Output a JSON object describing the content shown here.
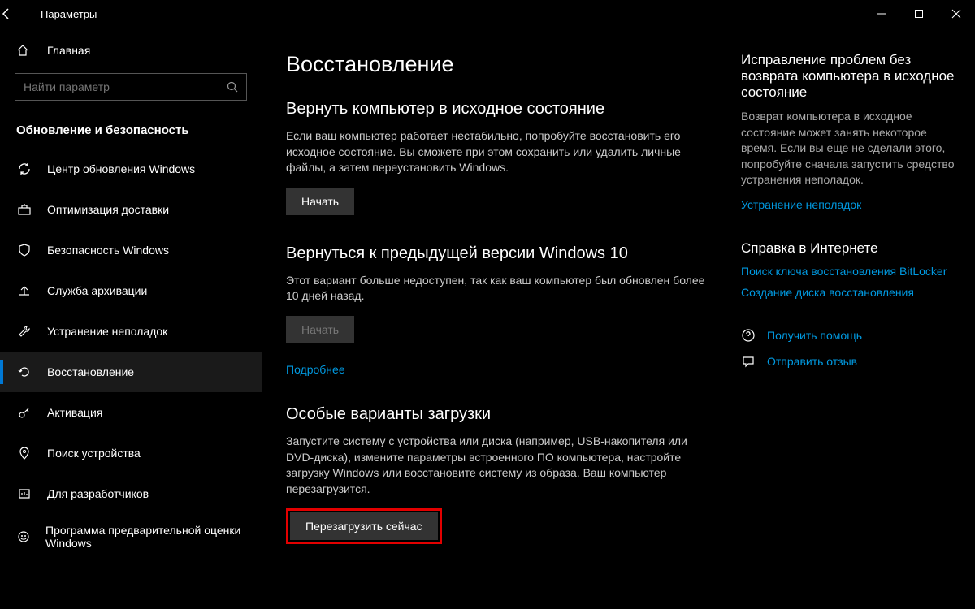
{
  "titlebar": {
    "title": "Параметры"
  },
  "sidebar": {
    "home": "Главная",
    "search_placeholder": "Найти параметр",
    "category": "Обновление и безопасность",
    "items": [
      {
        "label": "Центр обновления Windows"
      },
      {
        "label": "Оптимизация доставки"
      },
      {
        "label": "Безопасность Windows"
      },
      {
        "label": "Служба архивации"
      },
      {
        "label": "Устранение неполадок"
      },
      {
        "label": "Восстановление"
      },
      {
        "label": "Активация"
      },
      {
        "label": "Поиск устройства"
      },
      {
        "label": "Для разработчиков"
      },
      {
        "label": "Программа предварительной оценки Windows"
      }
    ]
  },
  "main": {
    "title": "Восстановление",
    "sections": {
      "reset": {
        "heading": "Вернуть компьютер в исходное состояние",
        "text": "Если ваш компьютер работает нестабильно, попробуйте восстановить его исходное состояние. Вы сможете при этом сохранить или удалить личные файлы, а затем переустановить Windows.",
        "button": "Начать"
      },
      "goback": {
        "heading": "Вернуться к предыдущей версии Windows 10",
        "text": "Этот вариант больше недоступен, так как ваш компьютер был обновлен более 10 дней назад.",
        "button": "Начать",
        "link": "Подробнее"
      },
      "advanced": {
        "heading": "Особые варианты загрузки",
        "text": "Запустите систему с устройства или диска (например, USB-накопителя или DVD-диска), измените параметры встроенного ПО компьютера, настройте загрузку Windows или восстановите систему из образа. Ваш компьютер перезагрузится.",
        "button": "Перезагрузить сейчас"
      }
    }
  },
  "right": {
    "fix": {
      "heading": "Исправление проблем без возврата компьютера в исходное состояние",
      "text": "Возврат компьютера в исходное состояние может занять некоторое время. Если вы еще не сделали этого, попробуйте сначала запустить средство устранения неполадок.",
      "link": "Устранение неполадок"
    },
    "help": {
      "heading": "Справка в Интернете",
      "link1": "Поиск ключа восстановления BitLocker",
      "link2": "Создание диска восстановления"
    },
    "bottom": {
      "help": "Получить помощь",
      "feedback": "Отправить отзыв"
    }
  }
}
